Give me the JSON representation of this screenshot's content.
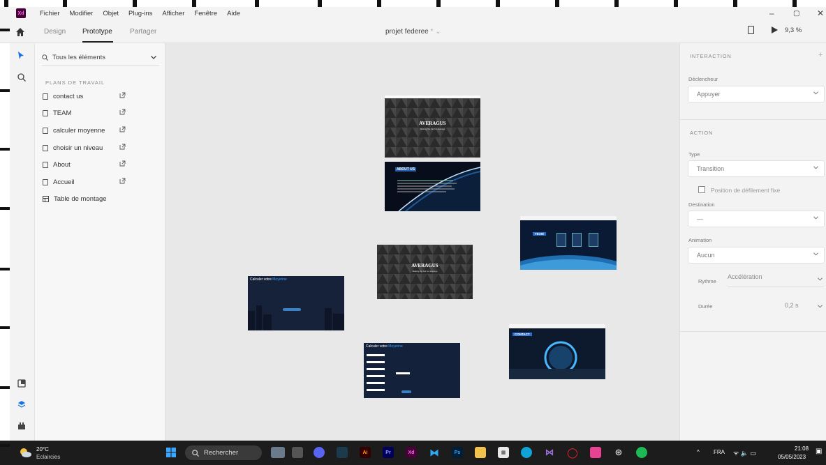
{
  "menubar": {
    "logo": "Xd",
    "items": [
      "Fichier",
      "Modifier",
      "Objet",
      "Plug-ins",
      "Afficher",
      "Fenêtre",
      "Aide"
    ],
    "window_controls": [
      "–",
      "▢",
      "✕"
    ]
  },
  "tabs": {
    "design": "Design",
    "prototype": "Prototype",
    "share": "Partager",
    "active": "Prototype"
  },
  "document": {
    "title": "projet federee",
    "modified_marker": "*",
    "dropdown": "⌄"
  },
  "toolbar_right": {
    "zoom": "9,3 %"
  },
  "layers": {
    "search_label": "Tous les éléments",
    "section_title": "PLANS DE TRAVAIL",
    "artboards": [
      "contact us",
      "TEAM",
      "calculer moyenne",
      "choisir un niveau",
      "About",
      "Accueil"
    ],
    "table_label": "Table de montage"
  },
  "canvas": {
    "boards": {
      "home1_title": "AVERAGUS",
      "home1_sub": "Making the bar for average",
      "about_title": "ABOUT US",
      "team_title": "TEAM",
      "home2_title": "AVERAGUS",
      "home2_sub": "Making the bar for average",
      "calc1_title": "Calculer votre",
      "calc1_title_accent": "Moyenne",
      "calc2_title": "Calculer votre",
      "calc2_title_accent": "Moyenne",
      "contact_title": "CONTACT"
    }
  },
  "inspector": {
    "interaction_title": "INTERACTION",
    "add": "+",
    "trigger_label": "Déclencheur",
    "trigger_value": "Appuyer",
    "action_title": "ACTION",
    "type_label": "Type",
    "type_value": "Transition",
    "scroll_checkbox": "Position de défilement fixe",
    "destination_label": "Destination",
    "destination_value": "—",
    "animation_label": "Animation",
    "animation_value": "Aucun",
    "easing_label": "Rythme",
    "easing_value": "Accélération",
    "duration_label": "Durée",
    "duration_value": "0,2 s"
  },
  "taskbar": {
    "weather_temp": "20°C",
    "weather_desc": "Eclaircies",
    "search": "Rechercher",
    "lang": "FRA",
    "time": "21:08",
    "date": "05/05/2023"
  },
  "colors": {
    "xd_purple": "#470137",
    "xd_pink": "#ff61f6",
    "accent_blue": "#1473e6",
    "taskbar": "#1c1c1c"
  }
}
